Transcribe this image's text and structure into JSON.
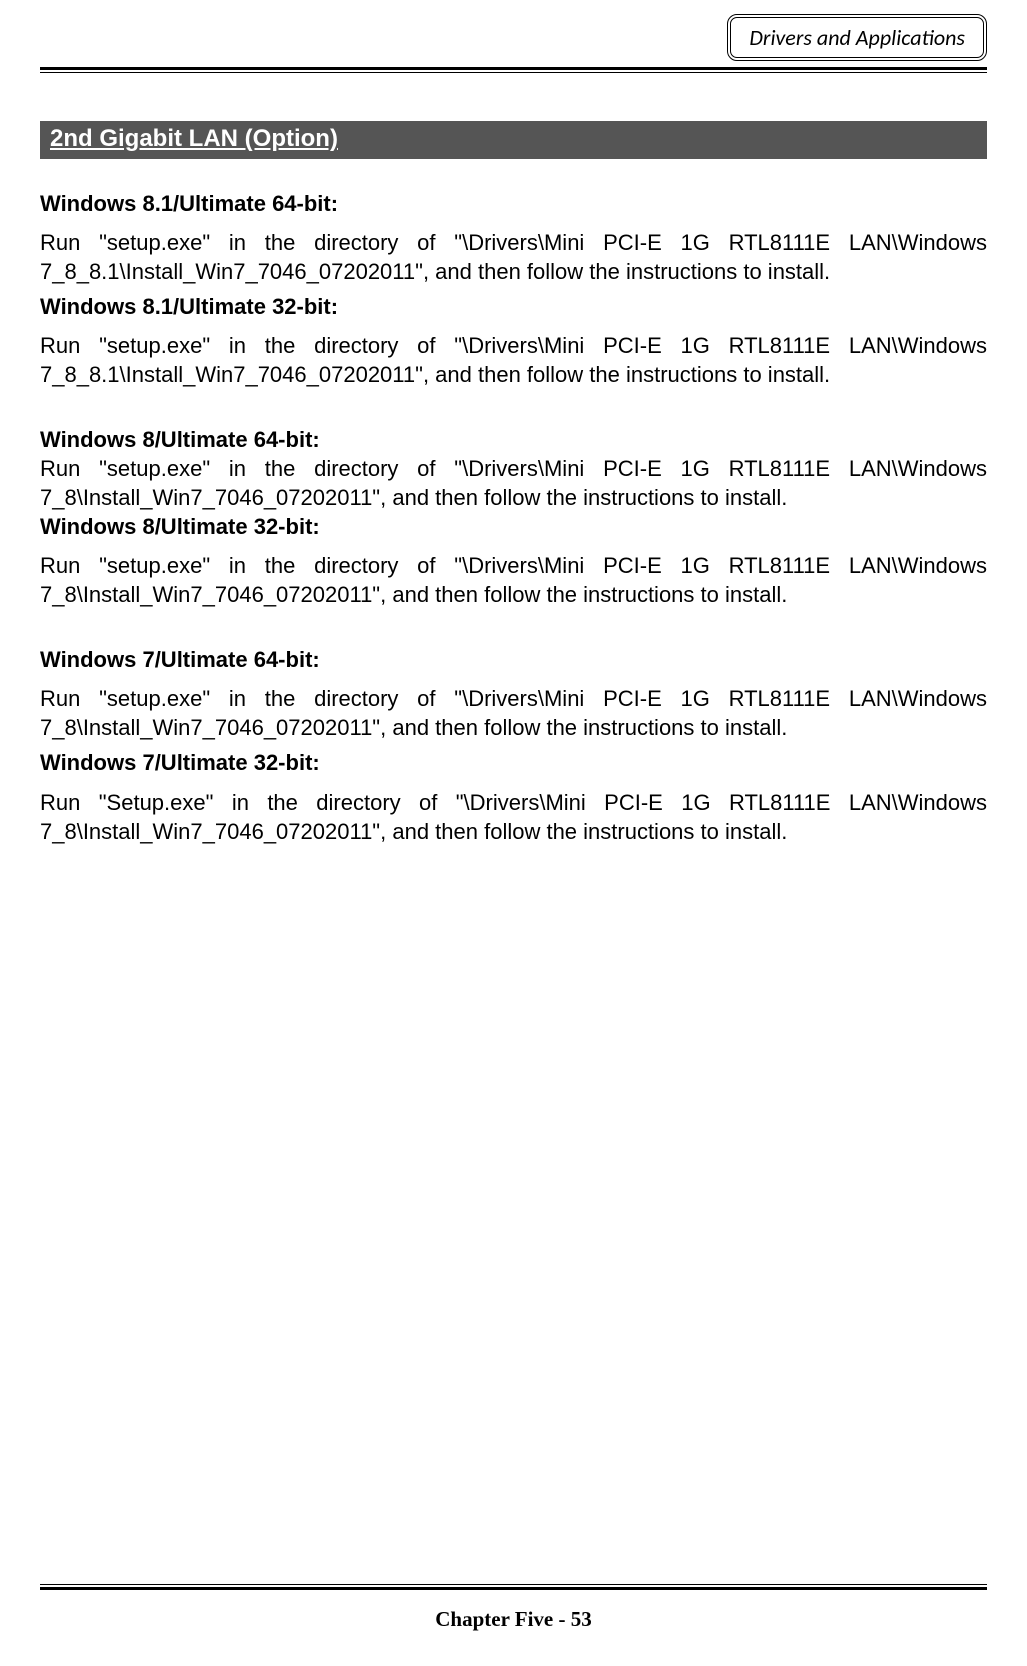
{
  "header": {
    "tag": "Drivers and Applications"
  },
  "section": {
    "title": " 2nd Gigabit LAN (Option) "
  },
  "entries": [
    {
      "heading": "Windows 8.1/Ultimate 64-bit:",
      "body": "Run \"setup.exe\" in the directory of \"\\Drivers\\Mini PCI-E 1G RTL8111E LAN\\Windows 7_8_8.1\\Install_Win7_7046_07202011\", and then follow the instructions to install."
    },
    {
      "heading": "Windows 8.1/Ultimate 32-bit:",
      "body": "Run \"setup.exe\" in the directory of \"\\Drivers\\Mini PCI-E 1G RTL8111E LAN\\Windows 7_8_8.1\\Install_Win7_7046_07202011\", and then follow the instructions to install."
    },
    {
      "heading": "Windows 8/Ultimate 64-bit:",
      "body": "Run \"setup.exe\" in the directory of \"\\Drivers\\Mini PCI-E 1G RTL8111E LAN\\Windows 7_8\\Install_Win7_7046_07202011\", and then follow the instructions to install."
    },
    {
      "heading": "Windows 8/Ultimate 32-bit:",
      "body": "Run \"setup.exe\" in the directory of \"\\Drivers\\Mini PCI-E 1G RTL8111E LAN\\Windows 7_8\\Install_Win7_7046_07202011\", and then follow the instructions to install."
    },
    {
      "heading": "Windows 7/Ultimate 64-bit:",
      "body": "Run \"setup.exe\" in the directory of \"\\Drivers\\Mini PCI-E 1G RTL8111E LAN\\Windows 7_8\\Install_Win7_7046_07202011\", and then follow the instructions to install."
    },
    {
      "heading": "Windows 7/Ultimate 32-bit:",
      "body": "Run \"Setup.exe\" in the directory of \"\\Drivers\\Mini PCI-E 1G RTL8111E LAN\\Windows 7_8\\Install_Win7_7046_07202011\", and then follow the instructions to install."
    }
  ],
  "footer": {
    "text": "Chapter Five - 53"
  }
}
